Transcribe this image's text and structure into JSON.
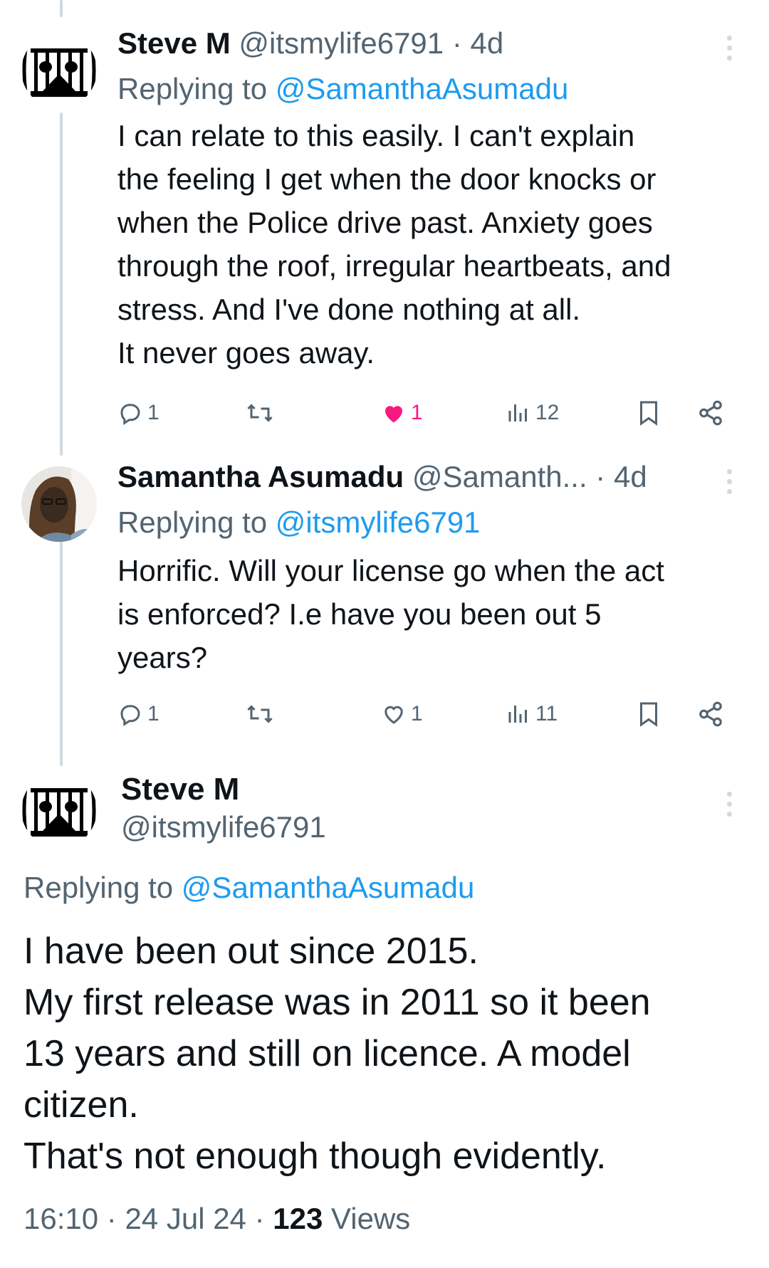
{
  "tweets": [
    {
      "name": "Steve M",
      "handle": "@itsmylife6791",
      "sep": "·",
      "time": "4d",
      "replying_label": "Replying to",
      "replying_to": "@SamanthaAsumadu",
      "text_lines": [
        "I can relate to this easily. I can't explain",
        "the feeling I get when the door knocks or",
        "when the Police drive past. Anxiety goes",
        "through the roof, irregular heartbeats, and",
        "stress. And I've done nothing at all.",
        "It never goes away."
      ],
      "replies": "1",
      "likes": "1",
      "liked": true,
      "views": "12"
    },
    {
      "name": "Samantha Asumadu",
      "handle": "@Samanth...",
      "sep": "·",
      "time": "4d",
      "replying_label": "Replying to",
      "replying_to": "@itsmylife6791",
      "text_lines": [
        "Horrific. Will your license go when the act",
        "is enforced? I.e have you been out 5",
        "years?"
      ],
      "replies": "1",
      "likes": "1",
      "liked": false,
      "views": "11"
    }
  ],
  "focus_tweet": {
    "name": "Steve M",
    "handle": "@itsmylife6791",
    "replying_label": "Replying to",
    "replying_to": "@SamanthaAsumadu",
    "text_lines": [
      "I have been out since 2015.",
      "My first release was in 2011 so it been",
      "13 years and still on licence. A model",
      "citizen.",
      "That's not enough though evidently."
    ],
    "time": "16:10",
    "sep": "·",
    "date": "24 Jul 24",
    "views_count": "123",
    "views_label": "Views"
  },
  "colors": {
    "link": "#1d9bf0",
    "like": "#f91880",
    "secondary_text": "#536471",
    "thread_line": "#cfd9de"
  },
  "icons": [
    "prison-bars-avatar",
    "profile-photo-avatar",
    "reply-icon",
    "retweet-icon",
    "heart-icon",
    "views-icon",
    "bookmark-icon",
    "share-icon",
    "more-icon"
  ]
}
